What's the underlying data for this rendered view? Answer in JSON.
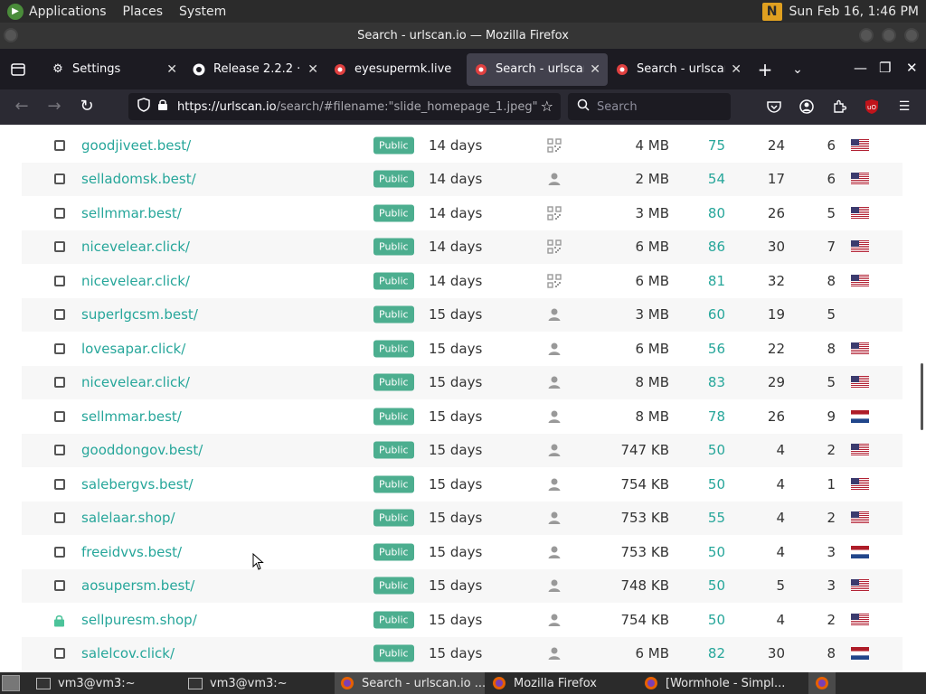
{
  "top_panel": {
    "menus": [
      "Applications",
      "Places",
      "System"
    ],
    "clock": "Sun Feb 16,  1:46 PM"
  },
  "window": {
    "title": "Search - urlscan.io — Mozilla Firefox"
  },
  "tabs": [
    {
      "label": "Settings",
      "icon": "gear-icon",
      "active": false
    },
    {
      "label": "Release 2.2.2 · t",
      "icon": "github-icon",
      "active": false
    },
    {
      "label": "eyesupermk.live",
      "icon": "urlscan-icon",
      "active": false
    },
    {
      "label": "Search - urlscan",
      "icon": "urlscan-icon",
      "active": true
    },
    {
      "label": "Search - urlscan",
      "icon": "urlscan-icon",
      "active": false
    }
  ],
  "nav": {
    "url_host": "https://urlscan.io",
    "url_rest": "/search/#filename:\"slide_homepage_1.jpeg\"",
    "search_placeholder": "Search"
  },
  "rows": [
    {
      "domain": "goodjiveet.best/",
      "visibility": "Public",
      "age": "14 days",
      "screenshot": "qr",
      "size": "4 MB",
      "score": "75",
      "c7": "24",
      "c8": "6",
      "flag": "us",
      "lock": false
    },
    {
      "domain": "selladomsk.best/",
      "visibility": "Public",
      "age": "14 days",
      "screenshot": "person",
      "size": "2 MB",
      "score": "54",
      "c7": "17",
      "c8": "6",
      "flag": "us",
      "lock": false
    },
    {
      "domain": "sellmmar.best/",
      "visibility": "Public",
      "age": "14 days",
      "screenshot": "qr",
      "size": "3 MB",
      "score": "80",
      "c7": "26",
      "c8": "5",
      "flag": "us",
      "lock": false
    },
    {
      "domain": "nicevelear.click/",
      "visibility": "Public",
      "age": "14 days",
      "screenshot": "qr",
      "size": "6 MB",
      "score": "86",
      "c7": "30",
      "c8": "7",
      "flag": "us",
      "lock": false
    },
    {
      "domain": "nicevelear.click/",
      "visibility": "Public",
      "age": "14 days",
      "screenshot": "qr",
      "size": "6 MB",
      "score": "81",
      "c7": "32",
      "c8": "8",
      "flag": "us",
      "lock": false
    },
    {
      "domain": "superlgcsm.best/",
      "visibility": "Public",
      "age": "15 days",
      "screenshot": "person",
      "size": "3 MB",
      "score": "60",
      "c7": "19",
      "c8": "5",
      "flag": "",
      "lock": false
    },
    {
      "domain": "lovesapar.click/",
      "visibility": "Public",
      "age": "15 days",
      "screenshot": "person",
      "size": "6 MB",
      "score": "56",
      "c7": "22",
      "c8": "8",
      "flag": "us",
      "lock": false
    },
    {
      "domain": "nicevelear.click/",
      "visibility": "Public",
      "age": "15 days",
      "screenshot": "person",
      "size": "8 MB",
      "score": "83",
      "c7": "29",
      "c8": "5",
      "flag": "us",
      "lock": false
    },
    {
      "domain": "sellmmar.best/",
      "visibility": "Public",
      "age": "15 days",
      "screenshot": "person",
      "size": "8 MB",
      "score": "78",
      "c7": "26",
      "c8": "9",
      "flag": "nl",
      "lock": false
    },
    {
      "domain": "gooddongov.best/",
      "visibility": "Public",
      "age": "15 days",
      "screenshot": "person",
      "size": "747 KB",
      "score": "50",
      "c7": "4",
      "c8": "2",
      "flag": "us",
      "lock": false
    },
    {
      "domain": "salebergvs.best/",
      "visibility": "Public",
      "age": "15 days",
      "screenshot": "person",
      "size": "754 KB",
      "score": "50",
      "c7": "4",
      "c8": "1",
      "flag": "us",
      "lock": false
    },
    {
      "domain": "salelaar.shop/",
      "visibility": "Public",
      "age": "15 days",
      "screenshot": "person",
      "size": "753 KB",
      "score": "55",
      "c7": "4",
      "c8": "2",
      "flag": "us",
      "lock": false
    },
    {
      "domain": "freeidvvs.best/",
      "visibility": "Public",
      "age": "15 days",
      "screenshot": "person",
      "size": "753 KB",
      "score": "50",
      "c7": "4",
      "c8": "3",
      "flag": "nl",
      "lock": false
    },
    {
      "domain": "aosupersm.best/",
      "visibility": "Public",
      "age": "15 days",
      "screenshot": "person",
      "size": "748 KB",
      "score": "50",
      "c7": "5",
      "c8": "3",
      "flag": "us",
      "lock": false
    },
    {
      "domain": "sellpuresm.shop/",
      "visibility": "Public",
      "age": "15 days",
      "screenshot": "person",
      "size": "754 KB",
      "score": "50",
      "c7": "4",
      "c8": "2",
      "flag": "us",
      "lock": true
    },
    {
      "domain": "salelcov.click/",
      "visibility": "Public",
      "age": "15 days",
      "screenshot": "person",
      "size": "6 MB",
      "score": "82",
      "c7": "30",
      "c8": "8",
      "flag": "nl",
      "lock": false
    }
  ],
  "taskbar": [
    {
      "label": "vm3@vm3:~",
      "icon": "terminal-icon",
      "active": false
    },
    {
      "label": "vm3@vm3:~",
      "icon": "terminal-icon",
      "active": false
    },
    {
      "label": "Search - urlscan.io ...",
      "icon": "firefox-icon",
      "active": true
    },
    {
      "label": "Mozilla Firefox",
      "icon": "firefox-icon",
      "active": false
    },
    {
      "label": "[Wormhole - Simpl...",
      "icon": "firefox-icon",
      "active": false
    }
  ],
  "colors": {
    "accent": "#26a69a",
    "badge": "#4cae8f",
    "tab_active": "#42414d"
  }
}
